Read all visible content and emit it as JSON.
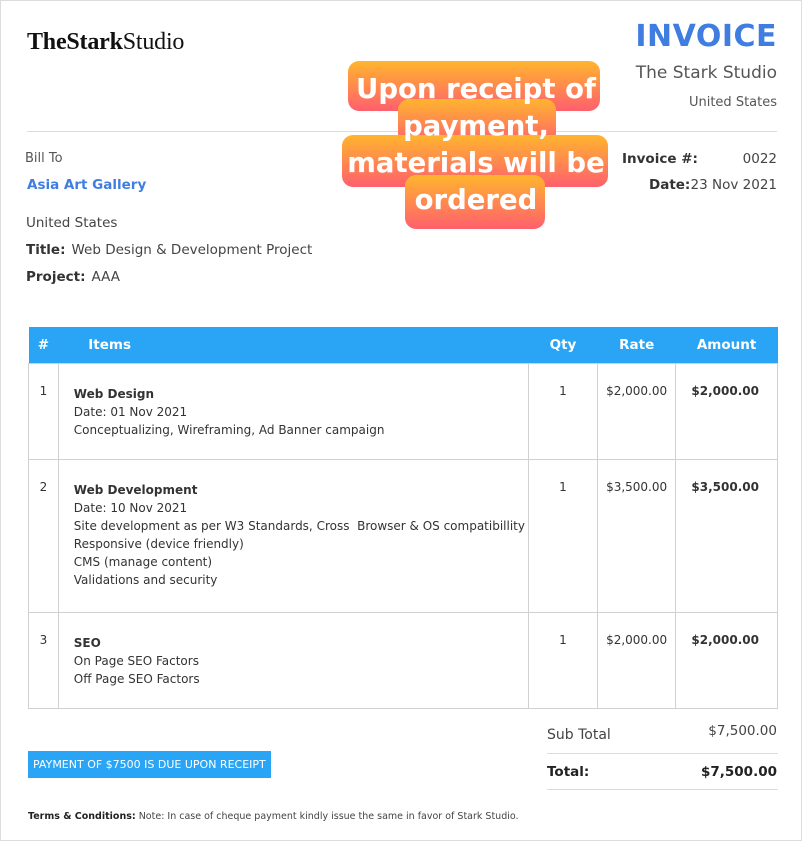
{
  "company": {
    "logo_part1": "TheStark",
    "logo_part2": "Studio",
    "name": "The Stark Studio",
    "country": "United States"
  },
  "invoice": {
    "heading": "INVOICE",
    "number_label": "Invoice #:",
    "number": "0022",
    "date_label": "Date:",
    "date": "23 Nov 2021"
  },
  "bill_to": {
    "label": "Bill To",
    "client": "Asia Art Gallery",
    "country": "United States",
    "title_label": "Title:",
    "title": "Web Design & Development Project",
    "project_label": "Project:",
    "project": "AAA"
  },
  "sticker": {
    "line1": "Upon receipt of",
    "line2": "payment,",
    "line3": "materials will be",
    "line4": "ordered"
  },
  "table": {
    "headers": {
      "num": "#",
      "items": "Items",
      "qty": "Qty",
      "rate": "Rate",
      "amount": "Amount"
    },
    "rows": [
      {
        "num": "1",
        "name": "Web Design",
        "details": [
          "Date: 01 Nov 2021",
          "Conceptualizing, Wireframing, Ad Banner campaign"
        ],
        "qty": "1",
        "rate": "$2,000.00",
        "amount": "$2,000.00"
      },
      {
        "num": "2",
        "name": "Web Development",
        "details": [
          "Date: 10 Nov 2021",
          "Site development as per W3 Standards, Cross  Browser & OS compatibillity",
          "Responsive (device friendly)",
          "CMS (manage content)",
          "Validations and security"
        ],
        "qty": "1",
        "rate": "$3,500.00",
        "amount": "$3,500.00"
      },
      {
        "num": "3",
        "name": "SEO",
        "details": [
          "On Page SEO Factors",
          "Off Page SEO Factors"
        ],
        "qty": "1",
        "rate": "$2,000.00",
        "amount": "$2,000.00"
      }
    ]
  },
  "totals": {
    "subtotal_label": "Sub Total",
    "subtotal": "$7,500.00",
    "total_label": "Total:",
    "total": "$7,500.00"
  },
  "due_badge": "PAYMENT OF $7500 IS DUE UPON RECEIPT",
  "terms": {
    "label": "Terms & Conditions:",
    "text": "Note: In case of cheque payment kindly issue the same in favor of Stark Studio."
  },
  "colors": {
    "accent": "#3f7ee0",
    "table_header": "#2aa5f5",
    "sticker_top": "#ffb52e",
    "sticker_bottom": "#ff5f6d"
  }
}
